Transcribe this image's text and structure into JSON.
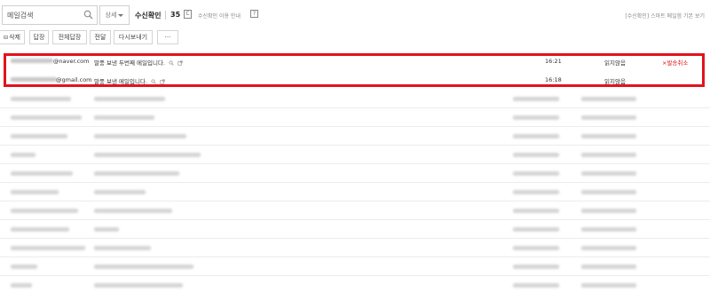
{
  "search": {
    "placeholder": "메일검색",
    "detail_label": "상세"
  },
  "receipt": {
    "title": "수신확인",
    "count": "35",
    "refresh_glyph": "C",
    "guide_label": "수신확인 이용 안내",
    "help_glyph": "?"
  },
  "settings_label": "[수신확인] 스마트 메일함 기본 보기",
  "toolbar": {
    "delete_label": "삭제",
    "reply_label": "답장",
    "reply_all_label": "전체답장",
    "forward_label": "전달",
    "resend_label": "다시보내기",
    "more_label": "···"
  },
  "mails": [
    {
      "sender": "@naver.com",
      "subject": "말풍 보낸 두번째 메일입니다.",
      "time": "16:21",
      "status": "읽지않음",
      "cancel": "×발송취소"
    },
    {
      "sender": "@gmail.com",
      "subject": "말풍 보낸 메일입니다.",
      "time": "16:18",
      "status": "읽지않음"
    }
  ],
  "colors": {
    "highlight": "#e2131c",
    "cancel_text": "#d11111",
    "divider": "#ececec"
  }
}
